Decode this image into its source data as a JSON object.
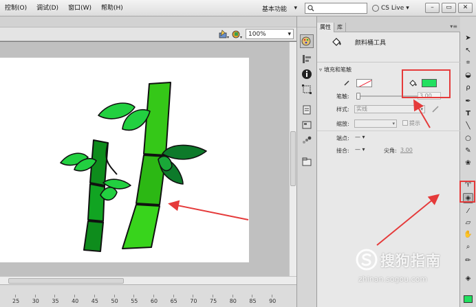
{
  "menubar": {
    "items": [
      "控制(O)",
      "调试(D)",
      "窗口(W)",
      "帮助(H)"
    ],
    "workspace_label": "基本功能",
    "search_placeholder": "",
    "cs_live_label": "CS Live"
  },
  "stage": {
    "zoom_value": "100%",
    "ruler_labels": [
      "25",
      "30",
      "35",
      "40",
      "45",
      "50",
      "55",
      "60",
      "65",
      "70",
      "75",
      "80",
      "85",
      "90"
    ]
  },
  "properties": {
    "tabs": [
      "属性",
      "库"
    ],
    "tool_name": "颜料桶工具",
    "section_title": "填充和笔触",
    "stroke_weight_label": "笔触:",
    "stroke_weight_value": "3.00",
    "style_label": "样式:",
    "style_value": "实线",
    "scale_label": "缩放:",
    "hint_label": "提示",
    "cap_label": "端点:",
    "join_label": "接合:",
    "miter_label": "尖角:",
    "miter_value": "3.00",
    "fill_color": "#22e060"
  },
  "colors": {
    "annotation_red": "#e53a3a",
    "bamboo_dark": "#0e8c1c",
    "bamboo_light": "#35c818",
    "leaf_dark": "#0d7a2a",
    "leaf_bright": "#22d040"
  },
  "watermark": {
    "brand": "搜狗指南",
    "url": "zhinan.sogou.com"
  }
}
